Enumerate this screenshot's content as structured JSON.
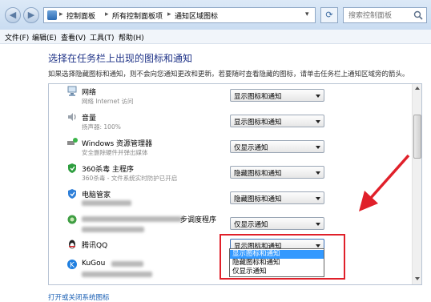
{
  "window": {
    "breadcrumb": [
      "控制面板",
      "所有控制面板项",
      "通知区域图标"
    ],
    "search_placeholder": "搜索控制面板"
  },
  "menu": [
    "文件(F)",
    "编辑(E)",
    "查看(V)",
    "工具(T)",
    "帮助(H)"
  ],
  "page": {
    "title": "选择在任务栏上出现的图标和通知",
    "description": "如果选择隐藏图标和通知，则不会向您通知更改和更新。若要随时查看隐藏的图标，请单击任务栏上通知区域旁的箭头。",
    "footer_link": "打开或关闭系统图标"
  },
  "items": [
    {
      "name": "网络",
      "sub": "网络 Internet 访问",
      "behavior": "显示图标和通知"
    },
    {
      "name": "音量",
      "sub": "扬声器: 100%",
      "behavior": "显示图标和通知"
    },
    {
      "name": "Windows 资源管理器",
      "sub": "安全删除硬件并弹出媒体",
      "behavior": "仅显示通知"
    },
    {
      "name": "360杀毒 主程序",
      "sub": "360杀毒 - 文件系统实时防护已开启",
      "behavior": "隐藏图标和通知"
    },
    {
      "name": "电脑管家",
      "sub": "",
      "behavior": "隐藏图标和通知"
    },
    {
      "name": "步调度程序",
      "sub": "",
      "behavior": "仅显示通知"
    },
    {
      "name": "腾讯QQ",
      "sub": "",
      "behavior": "显示图标和通知"
    },
    {
      "name": "KuGou",
      "sub": "",
      "behavior": ""
    }
  ],
  "dropdown_options": [
    "显示图标和通知",
    "隐藏图标和通知",
    "仅显示通知"
  ],
  "colors": {
    "title": "#1e3287",
    "link": "#1a5fb4",
    "highlight": "#3399ff",
    "annotation": "#e0202a"
  }
}
